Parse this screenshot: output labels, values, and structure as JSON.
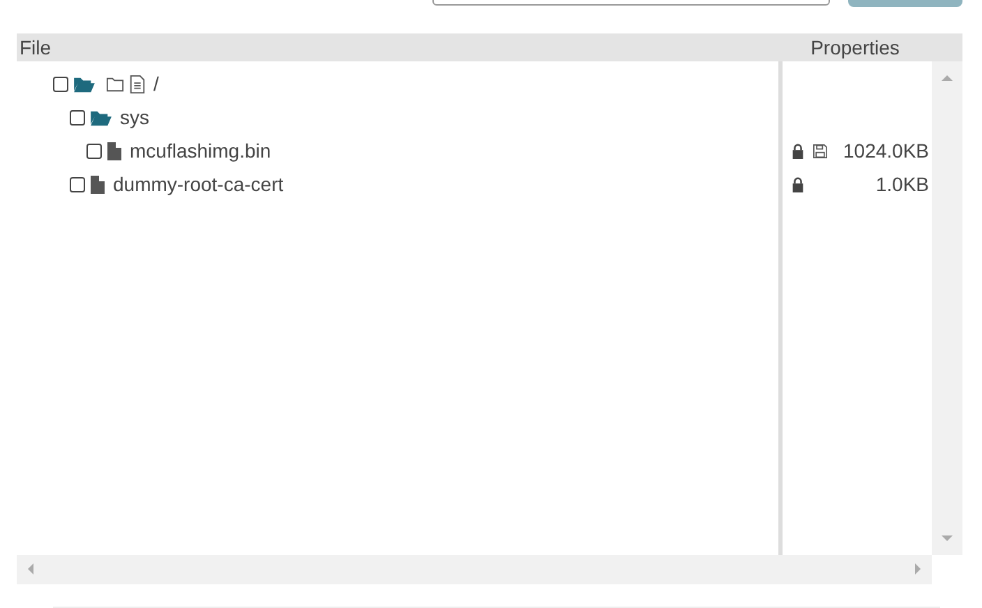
{
  "table": {
    "columns": [
      {
        "label": "File"
      },
      {
        "label": "Properties"
      }
    ],
    "tree": [
      {
        "kind": "folder",
        "name": "/",
        "checked": false,
        "expanded": true,
        "root_actions": true,
        "children": [
          {
            "kind": "folder",
            "name": "sys",
            "checked": false,
            "expanded": true,
            "children": [
              {
                "kind": "file",
                "name": "mcuflashimg.bin",
                "checked": false,
                "locked": true,
                "disk": true,
                "size": "1024.0KB"
              }
            ]
          },
          {
            "kind": "file",
            "name": "dummy-root-ca-cert",
            "checked": false,
            "locked": true,
            "disk": false,
            "size": "1.0KB"
          }
        ]
      }
    ]
  }
}
